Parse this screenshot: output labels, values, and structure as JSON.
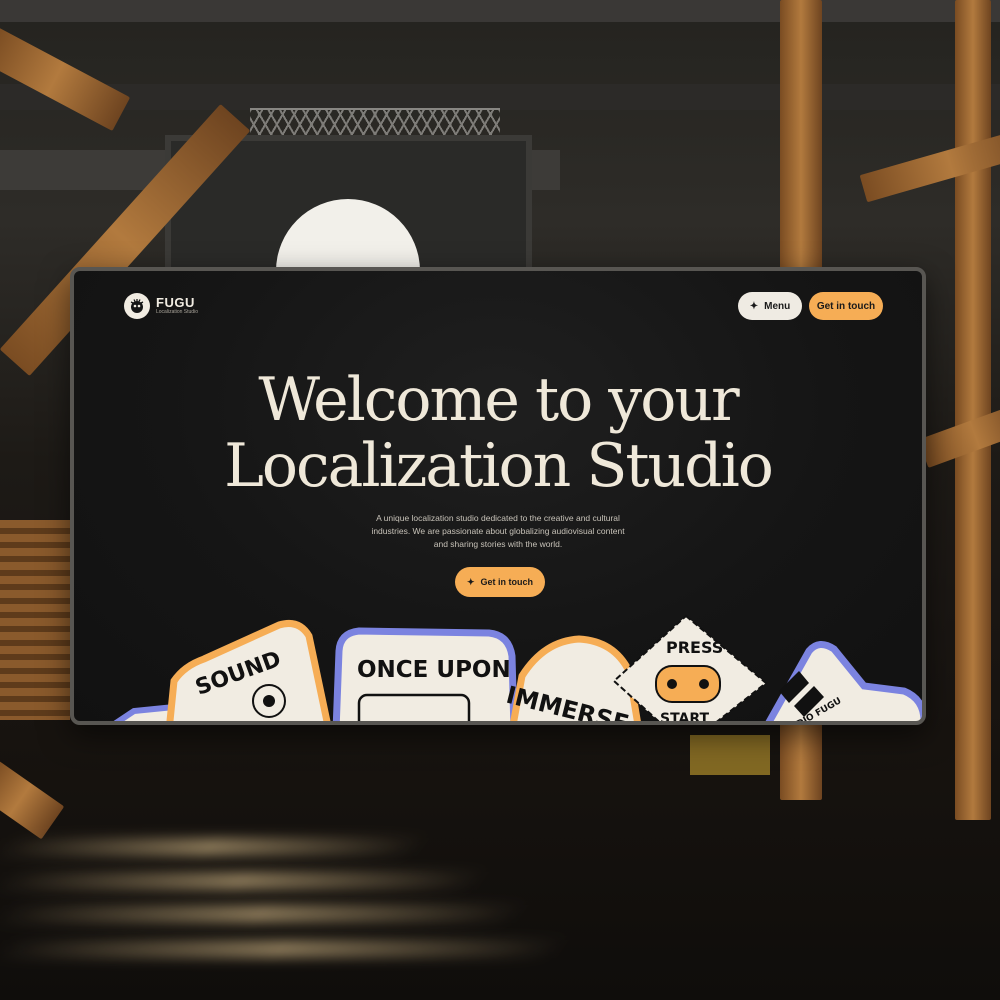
{
  "brand": {
    "name": "FUGU",
    "tagline": "Localization Studio",
    "icon": "fugu-logo-icon"
  },
  "nav": {
    "menu_label": "Menu",
    "menu_icon": "sparkle-icon",
    "contact_label": "Get in touch"
  },
  "hero": {
    "title_line1": "Welcome to your",
    "title_line2": "Localization Studio",
    "subtitle": "A unique localization studio dedicated to the creative and cultural industries. We are passionate about globalizing audiovisual content and sharing stories with the world.",
    "cta_label": "Get in touch",
    "cta_icon": "sparkle-icon"
  },
  "stickers": [
    {
      "label": "SOUND",
      "border": "#f6ad55"
    },
    {
      "label": "ONCE UPON",
      "border": "#7b83e0"
    },
    {
      "label": "IMMERSE",
      "border": "#f6ad55"
    },
    {
      "label": "PRESS",
      "border": "#f1ece2"
    },
    {
      "label": "START",
      "border": "#f1ece2"
    },
    {
      "label": "STUDIO FUGU",
      "border": "#7b83e0"
    }
  ],
  "billboard": {
    "icon": "fugu-face-icon"
  },
  "colors": {
    "accent": "#f6ad55",
    "background": "#151515",
    "text": "#efe8d9",
    "sticker_blue": "#7b83e0"
  }
}
